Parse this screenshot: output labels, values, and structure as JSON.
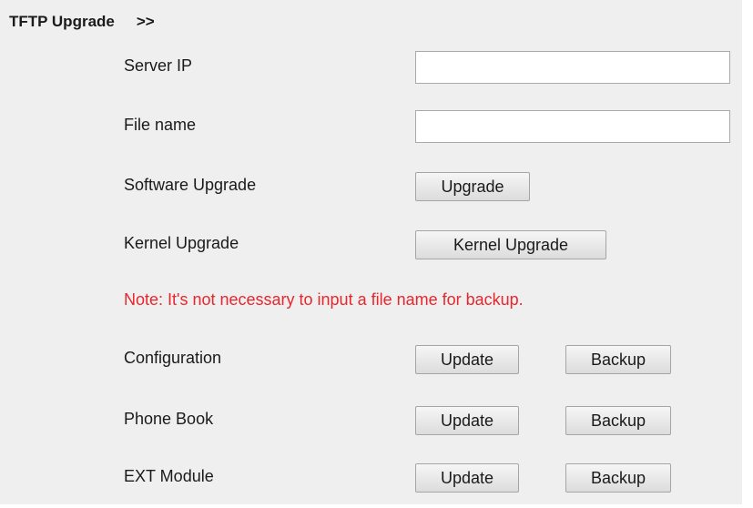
{
  "section": {
    "title": "TFTP Upgrade",
    "arrows": ">>"
  },
  "fields": {
    "server_ip": {
      "label": "Server IP",
      "value": "",
      "placeholder": ""
    },
    "file_name": {
      "label": "File name",
      "value": "",
      "placeholder": ""
    }
  },
  "software_upgrade": {
    "label": "Software Upgrade",
    "button": "Upgrade"
  },
  "kernel_upgrade": {
    "label": "Kernel Upgrade",
    "button": "Kernel Upgrade"
  },
  "note": "Note: It's not necessary to input a file name for backup.",
  "configuration": {
    "label": "Configuration",
    "update": "Update",
    "backup": "Backup"
  },
  "phone_book": {
    "label": "Phone Book",
    "update": "Update",
    "backup": "Backup"
  },
  "ext_module": {
    "label": "EXT Module",
    "update": "Update",
    "backup": "Backup"
  },
  "colors": {
    "panel_background": "#efefef",
    "note_text": "#e8262d"
  }
}
